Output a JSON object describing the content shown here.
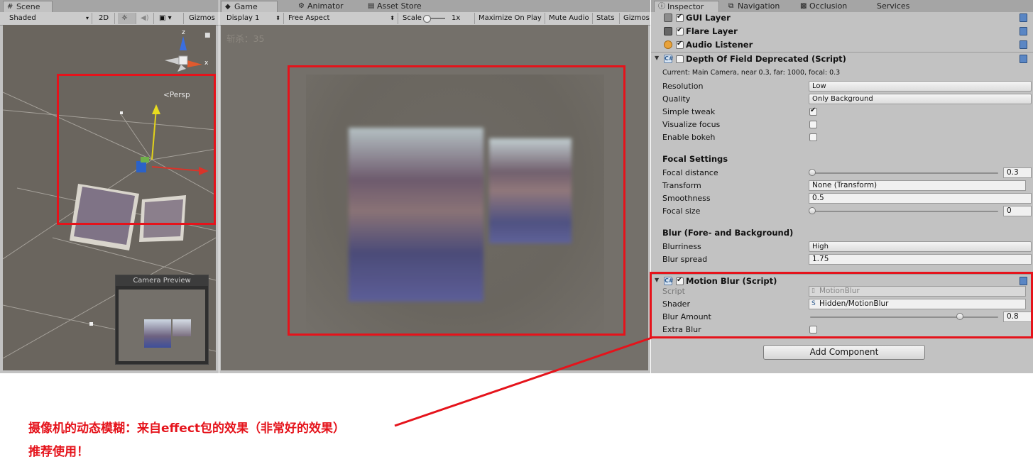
{
  "scene": {
    "tab": "Scene",
    "shading": "Shaded",
    "mode_2d": "2D",
    "gizmos": "Gizmos",
    "persp": "Persp",
    "axis_x": "x",
    "axis_z": "z",
    "camera_preview": "Camera Preview"
  },
  "game": {
    "tabs": [
      "Game",
      "Animator",
      "Asset Store"
    ],
    "display": "Display 1",
    "aspect": "Free Aspect",
    "scale_label": "Scale",
    "scale_value": "1x",
    "maximize": "Maximize On Play",
    "mute": "Mute Audio",
    "stats": "Stats",
    "gizmos": "Gizmos",
    "hud": "斩杀：35"
  },
  "inspector": {
    "tabs": [
      "Inspector",
      "Navigation",
      "Occlusion",
      "Services"
    ],
    "components_top": [
      {
        "name": "GUI Layer",
        "enabled": true
      },
      {
        "name": "Flare Layer",
        "enabled": true
      },
      {
        "name": "Audio Listener",
        "enabled": true
      }
    ],
    "dof": {
      "title": "Depth Of Field Deprecated (Script)",
      "enabled": false,
      "current": "Current: Main Camera, near 0.3, far: 1000, focal: 0.3",
      "resolution_label": "Resolution",
      "resolution": "Low",
      "quality_label": "Quality",
      "quality": "Only Background",
      "simple_tweak_label": "Simple tweak",
      "simple_tweak": true,
      "visualize_focus_label": "Visualize focus",
      "visualize_focus": false,
      "enable_bokeh_label": "Enable bokeh",
      "enable_bokeh": false,
      "focal_settings": "Focal Settings",
      "focal_distance_label": "Focal distance",
      "focal_distance": "0.3",
      "focal_distance_frac": 0,
      "transform_label": "Transform",
      "transform": "None (Transform)",
      "smoothness_label": "Smoothness",
      "smoothness": "0.5",
      "focal_size_label": "Focal size",
      "focal_size": "0",
      "focal_size_frac": 0,
      "blur_section": "Blur (Fore- and Background)",
      "blurriness_label": "Blurriness",
      "blurriness": "High",
      "blur_spread_label": "Blur spread",
      "blur_spread": "1.75"
    },
    "motion_blur": {
      "title": "Motion Blur (Script)",
      "enabled": true,
      "script_label": "Script",
      "script": "MotionBlur",
      "shader_label": "Shader",
      "shader": "Hidden/MotionBlur",
      "blur_amount_label": "Blur Amount",
      "blur_amount": "0.8",
      "blur_amount_frac": 0.8,
      "extra_blur_label": "Extra Blur",
      "extra_blur": false
    },
    "add_component": "Add Component"
  },
  "annotation": {
    "line1": "摄像机的动态模糊：来自effect包的效果（非常好的效果）",
    "line2": "推荐使用！",
    "color": "#e5131b"
  }
}
